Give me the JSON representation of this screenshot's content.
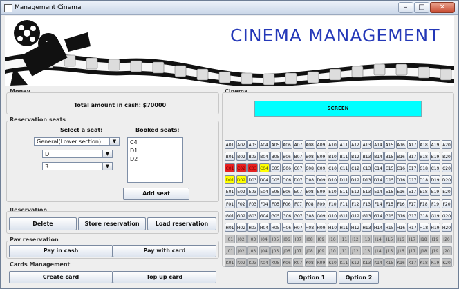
{
  "window": {
    "title": "Management Cinema"
  },
  "banner": {
    "title": "CINEMA MANAGEMENT"
  },
  "money": {
    "section": "Money",
    "total_label": "Total amount in cash: $70000"
  },
  "reservation_seats": {
    "section": "Reservation seats",
    "select_label": "Select a seat:",
    "booked_label": "Booked seats:",
    "section_select": "General(Lower section)",
    "row_select": "D",
    "number_select": "3",
    "booked": [
      "C4",
      "D1",
      "D2"
    ],
    "add_seat": "Add seat"
  },
  "reservation": {
    "section": "Reservation",
    "delete": "Delete",
    "store": "Store reservation",
    "load": "Load reservation"
  },
  "pay": {
    "section": "Pay reservation",
    "cash": "Pay in cash",
    "card": "Pay with card"
  },
  "cards": {
    "section": "Cards Management",
    "create": "Create card",
    "topup": "Top up card"
  },
  "cinema": {
    "section": "Cinema",
    "screen": "SCREEN",
    "rows": [
      "A",
      "B",
      "C",
      "D",
      "E",
      "F",
      "G",
      "H",
      "I",
      "J",
      "K"
    ],
    "seats_per_row": 20,
    "red_seats": [
      "C01",
      "C02",
      "C03"
    ],
    "yellow_seats": [
      "C04",
      "D01",
      "D02"
    ],
    "grey_rows": [
      "I",
      "J",
      "K"
    ]
  },
  "options": {
    "option1": "Option 1",
    "option2": "Option 2"
  }
}
